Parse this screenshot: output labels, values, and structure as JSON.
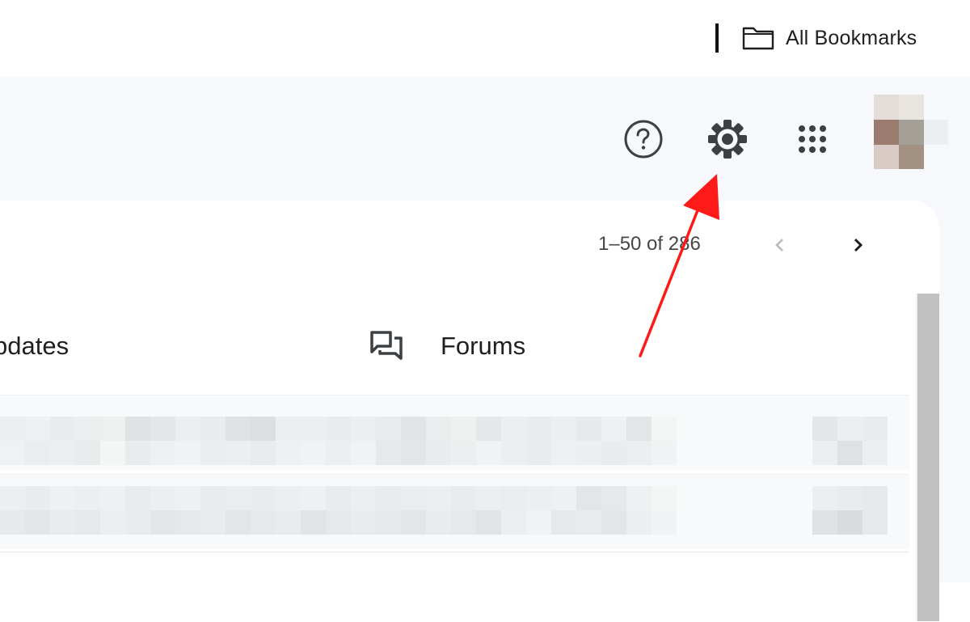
{
  "bookmarks_bar": {
    "folder_icon": "folder-icon",
    "folder_label": "All Bookmarks"
  },
  "header": {
    "help_icon": "help-icon",
    "settings_icon": "gear-icon",
    "apps_icon": "apps-grid-icon",
    "avatar": "avatar"
  },
  "toolbar": {
    "pagination": "1–50 of 286",
    "prev_icon": "chevron-left-icon",
    "next_icon": "chevron-right-icon"
  },
  "tabs": [
    {
      "label": "pdates",
      "icon": "updates-icon"
    },
    {
      "label": "Forums",
      "icon": "forums-icon"
    }
  ],
  "annotation": {
    "color": "#ff1a1a",
    "points_to": "gear-icon"
  },
  "colors": {
    "app_background": "#f6f8fc",
    "card": "#ffffff",
    "text": "#1f1f1f",
    "muted": "#444746",
    "scrollbar": "#c1c1c1"
  }
}
